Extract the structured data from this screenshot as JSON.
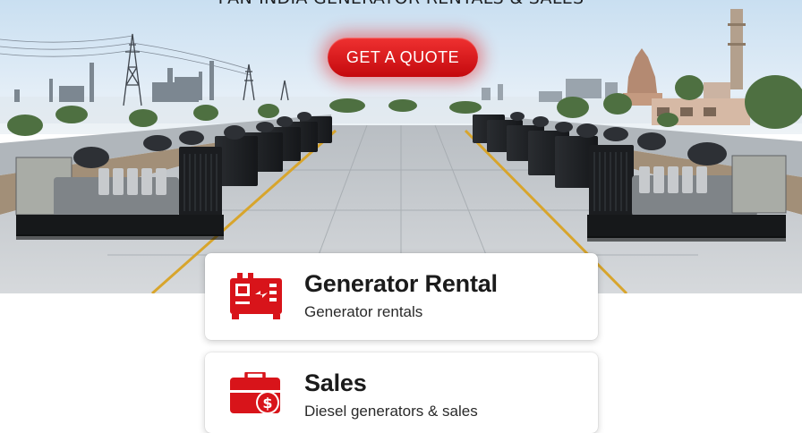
{
  "hero": {
    "title": "PAN-INDIA GENERATOR RENTALS & SALES",
    "cta_label": "GET A QUOTE"
  },
  "services": [
    {
      "title": "Generator Rental",
      "subtitle": "Generator rentals",
      "icon": "generator-icon"
    },
    {
      "title": "Sales",
      "subtitle": "Diesel generators & sales",
      "icon": "briefcase-dollar-icon"
    }
  ],
  "colors": {
    "accent": "#d8141a",
    "card_bg": "#ffffff",
    "text": "#1b1b1b"
  }
}
